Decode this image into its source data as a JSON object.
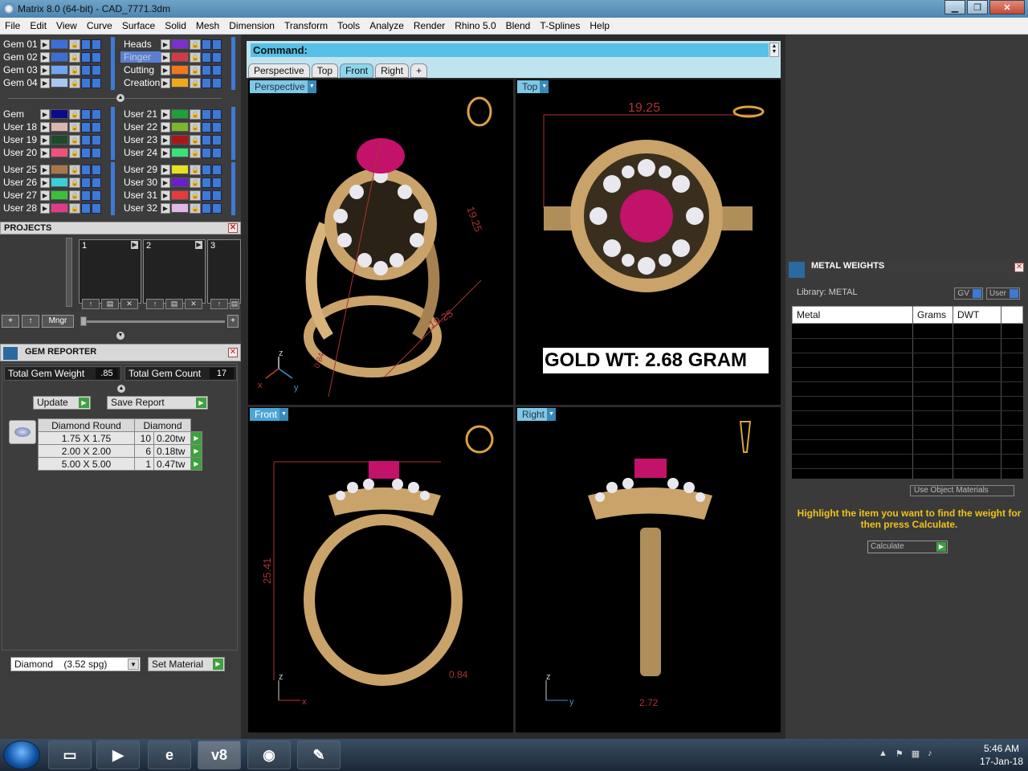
{
  "window": {
    "title": "Matrix 8.0 (64-bit) - CAD_7771.3dm",
    "minimize": "▁",
    "maximize": "❐",
    "close": "✕"
  },
  "menu": [
    "File",
    "Edit",
    "View",
    "Curve",
    "Surface",
    "Solid",
    "Mesh",
    "Dimension",
    "Transform",
    "Tools",
    "Analyze",
    "Render",
    "Rhino 5.0",
    "Blend",
    "T-Splines",
    "Help"
  ],
  "layers": {
    "group1_left": [
      {
        "name": "Gem 01",
        "color": "#3a6fd8"
      },
      {
        "name": "Gem 02",
        "color": "#3a6fd8"
      },
      {
        "name": "Gem 03",
        "color": "#6fa6f0"
      },
      {
        "name": "Gem 04",
        "color": "#a8c6f4"
      }
    ],
    "group1_right": [
      {
        "name": "Heads",
        "color": "#7a2fd0"
      },
      {
        "name": "Finger",
        "color": "#d23a4a"
      },
      {
        "name": "Cutting",
        "color": "#f07820"
      },
      {
        "name": "Creation",
        "color": "#f0a820"
      }
    ],
    "group2_left": [
      {
        "name": "Gem",
        "color": "#0a0a8a"
      },
      {
        "name": "User 18",
        "color": "#d8b8b0"
      },
      {
        "name": "User 19",
        "color": "#1e4a2a"
      },
      {
        "name": "User 20",
        "color": "#f0507a"
      }
    ],
    "group2_right": [
      {
        "name": "User 21",
        "color": "#1ea03a"
      },
      {
        "name": "User 22",
        "color": "#7ab82a"
      },
      {
        "name": "User 23",
        "color": "#a81818"
      },
      {
        "name": "User 24",
        "color": "#3ae07a"
      }
    ],
    "group3_left": [
      {
        "name": "User 25",
        "color": "#a8784a"
      },
      {
        "name": "User 26",
        "color": "#3ad0d8"
      },
      {
        "name": "User 27",
        "color": "#3ac03a"
      },
      {
        "name": "User 28",
        "color": "#e03a8a"
      }
    ],
    "group3_right": [
      {
        "name": "User 29",
        "color": "#e8e020"
      },
      {
        "name": "User 30",
        "color": "#6a20c8"
      },
      {
        "name": "User 31",
        "color": "#e83a3a"
      },
      {
        "name": "User 32",
        "color": "#e0b8e8"
      }
    ]
  },
  "projects": {
    "title": "PROJECTS",
    "slots": [
      "1",
      "2",
      "3"
    ],
    "mngr": "Mngr",
    "add": "+",
    "up": "↑"
  },
  "gem_reporter": {
    "title": "GEM REPORTER",
    "total_weight_label": "Total Gem Weight",
    "total_weight": ".85",
    "total_count_label": "Total Gem Count",
    "total_count": "17",
    "update": "Update",
    "save_report": "Save Report",
    "table_headers": [
      "Diamond Round",
      "Diamond"
    ],
    "rows": [
      {
        "size": "1.75 X 1.75",
        "count": "10",
        "weight": "0.20tw"
      },
      {
        "size": "2.00 X 2.00",
        "count": "6",
        "weight": "0.18tw"
      },
      {
        "size": "5.00 X 5.00",
        "count": "1",
        "weight": "0.47tw"
      }
    ],
    "material": "Diamond    (3.52 spg)",
    "set_material": "Set Material"
  },
  "command": {
    "label": "Command:"
  },
  "viewport_tabs": [
    "Perspective",
    "Top",
    "Front",
    "Right",
    "+"
  ],
  "viewports": {
    "perspective": {
      "label": "Perspective",
      "dim1": "19.25",
      "dim2": "19.25",
      "dim3": "0.84"
    },
    "top": {
      "label": "Top",
      "dim": "19.25",
      "gold_wt": "GOLD WT: 2.68 GRAM"
    },
    "front": {
      "label": "Front",
      "dim_h": "25.41",
      "dim_w": "0.84"
    },
    "right": {
      "label": "Right",
      "dim": "2.72"
    }
  },
  "axes": {
    "x": "x",
    "y": "y",
    "z": "z"
  },
  "metal_weights": {
    "title": "METAL WEIGHTS",
    "library": "Library: METAL",
    "gv": "GV",
    "user": "User",
    "headers": [
      "Metal",
      "Grams",
      "DWT"
    ],
    "use_object_materials": "Use Object Materials",
    "hint": "Highlight the item you want to find the weight for then press Calculate.",
    "calculate": "Calculate"
  },
  "taskbar": {
    "time": "5:46 AM",
    "date": "17-Jan-18",
    "v8": "v8"
  }
}
